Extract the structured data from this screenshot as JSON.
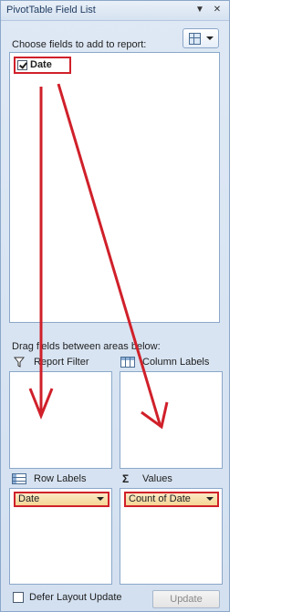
{
  "pane": {
    "title": "PivotTable Field List",
    "dropdown_glyph": "▼",
    "close_glyph": "✕"
  },
  "fields": {
    "choose_label": "Choose fields to add to report:",
    "items": [
      {
        "label": "Date",
        "checked": true
      }
    ]
  },
  "areas": {
    "drag_label": "Drag fields between areas below:",
    "report_filter": {
      "label": "Report Filter",
      "icon": "filter-icon",
      "glyph": "⊽"
    },
    "column_labels": {
      "label": "Column Labels",
      "icon": "column-labels-icon"
    },
    "row_labels": {
      "label": "Row Labels",
      "icon": "row-labels-icon",
      "items": [
        "Date"
      ]
    },
    "values": {
      "label": "Values",
      "icon": "sigma-icon",
      "glyph": "Σ",
      "items": [
        "Count of Date"
      ]
    }
  },
  "footer": {
    "defer_label": "Defer Layout Update",
    "defer_checked": false,
    "update_label": "Update"
  },
  "colors": {
    "highlight": "#d0202a",
    "annotation_arrow": "#d0202a",
    "pane_border": "#8ba7c9"
  }
}
